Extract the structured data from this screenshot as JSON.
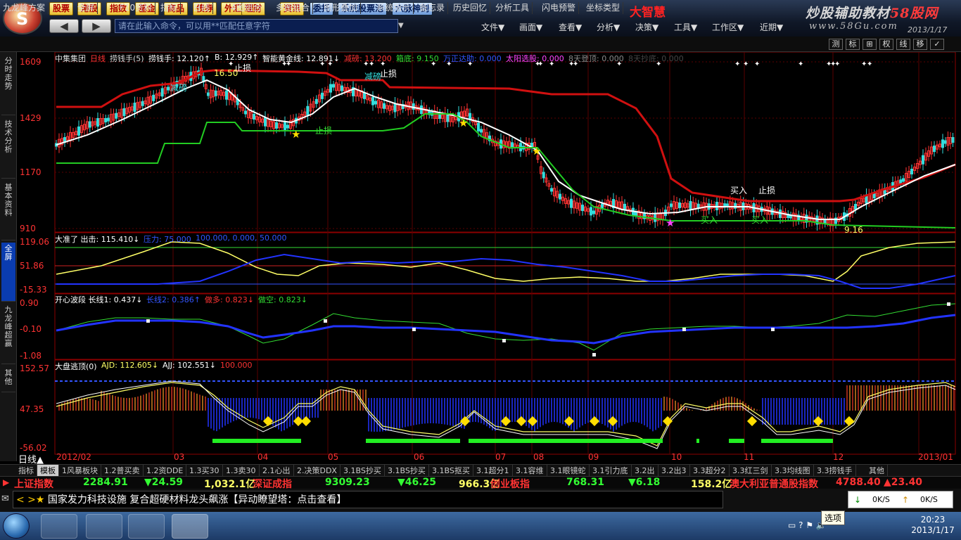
{
  "top_menu": [
    "股票",
    "港股",
    "指数",
    "基金",
    "商品",
    "债券",
    "外汇",
    "理财",
    "资讯",
    "委托",
    "系统股票池",
    "六脉神剑"
  ],
  "brand": "大智慧",
  "watermark": {
    "line1a": "炒股辅助教材",
    "line1b": "58股网",
    "line2": "www.58Gu.com",
    "date": "2013/1/17"
  },
  "command": {
    "placeholder": "请在此输入命令，可以用**匹配任意字符"
  },
  "main_menu": [
    "文件▼",
    "画面▼",
    "查看▼",
    "分析▼",
    "决策▼",
    "工具▼",
    "工作区▼",
    "近期▼"
  ],
  "toolbar2": [
    "九龙峰方案",
    "全屏",
    "F10资料",
    "指标",
    "日线",
    "4图组合",
    "多图组合",
    "图形叠加",
    "系统指示",
    "备忘录",
    "历史回忆",
    "分析工具",
    "闪电预警",
    "坐标类型"
  ],
  "right_btns": [
    "测",
    "标",
    "⊞",
    "权",
    "线",
    "移",
    "✓"
  ],
  "left_tabs": [
    "分时走势",
    "技术分析",
    "基本资料",
    "全屏",
    "九龙峰超赢",
    "其他"
  ],
  "main_panel": {
    "header": [
      {
        "t": "中集集团",
        "c": "#ddd"
      },
      {
        "t": "日线",
        "c": "#ff3333"
      },
      {
        "t": "捞钱手(5)",
        "c": "#ddd"
      },
      {
        "t": "捞钱手: 12.120↑",
        "c": "#fff"
      },
      {
        "t": "B: 12.929↑",
        "c": "#fff"
      },
      {
        "t": "智能黄金线: 12.891↓",
        "c": "#fff"
      },
      {
        "t": "减磅: 13.200",
        "c": "#ff3333"
      },
      {
        "t": "箱底: 9.150",
        "c": "#33dd33"
      },
      {
        "t": "万正达助: 0.000",
        "c": "#3355ff"
      },
      {
        "t": "太阳选股: 0.000",
        "c": "#ff44ff"
      },
      {
        "t": "8天登顶: 0.000",
        "c": "#888"
      },
      {
        "t": "8天抄底: 0.000",
        "c": "#444"
      }
    ],
    "y_labels": [
      "1609",
      "1429",
      "1170",
      "910"
    ],
    "annotations": [
      "减磅",
      "止损",
      "16.50",
      "减磅",
      "止损",
      "买入",
      "止损",
      "止损",
      "买入",
      "买入",
      "9.16"
    ]
  },
  "panel2": {
    "header": [
      {
        "t": "大准了 出击: 115.410↓",
        "c": "#fff"
      },
      {
        "t": "压力: 75.000",
        "c": "#3355ff"
      },
      {
        "t": "100.000, 0.000, 50.000",
        "c": "#3355ff"
      }
    ],
    "y_labels": [
      "119.06",
      "51.86",
      "-15.33"
    ]
  },
  "panel3": {
    "header": [
      {
        "t": "开心波段 长线1: 0.437↓",
        "c": "#fff"
      },
      {
        "t": "长线2: 0.386↑",
        "c": "#3355ff"
      },
      {
        "t": "做多: 0.823↓",
        "c": "#ff3333"
      },
      {
        "t": "做空: 0.823↓",
        "c": "#33dd33"
      }
    ],
    "y_labels": [
      "0.90",
      "-0.10",
      "-1.08"
    ]
  },
  "panel4": {
    "header": [
      {
        "t": "大盘逃顶(0)",
        "c": "#fff"
      },
      {
        "t": "AJD: 112.605↓",
        "c": "#ffff66"
      },
      {
        "t": "AJJ: 102.551↓",
        "c": "#fff"
      },
      {
        "t": "100.000",
        "c": "#ff3333"
      }
    ],
    "y_labels": [
      "152.57",
      "47.35",
      "-56.02"
    ]
  },
  "x_labels": [
    "2012/02",
    "03",
    "04",
    "05",
    "06",
    "07",
    "08",
    "09",
    "10",
    "11",
    "12",
    "2013/01"
  ],
  "period": "日线▲",
  "formula_tabs": [
    "指标",
    "模板",
    "1风暴板块",
    "1.2普买卖",
    "1.2资DDE",
    "1.3买30",
    "1.3卖30",
    "2.1心出",
    "2.决策DDX",
    "3.1BS抄买",
    "3.1BS抄买",
    "3.1BS抠买",
    "3.1超分1",
    "3.1容维",
    "3.1眼镜蛇",
    "3.1引力底",
    "3.2出",
    "3.2出3",
    "3.3超分2",
    "3.3红三剑",
    "3.3均线图",
    "3.3捞钱手",
    "其他"
  ],
  "ticker": [
    {
      "t": "上证指数",
      "c": "#ff3333"
    },
    {
      "t": "2284.91",
      "c": "#33ff33"
    },
    {
      "t": "▼24.59",
      "c": "#33ff33"
    },
    {
      "t": "1,032.1亿",
      "c": "#ffff66"
    },
    {
      "t": "深证成指",
      "c": "#ff3333"
    },
    {
      "t": "9309.23",
      "c": "#33ff33"
    },
    {
      "t": "▼46.25",
      "c": "#33ff33"
    },
    {
      "t": "966.3亿",
      "c": "#ffff66"
    },
    {
      "t": "创业板指",
      "c": "#ff3333"
    },
    {
      "t": "768.31",
      "c": "#33ff33"
    },
    {
      "t": "▼6.18",
      "c": "#33ff33"
    },
    {
      "t": "158.2亿",
      "c": "#ffff66"
    },
    {
      "t": "澳大利亚普通股指数",
      "c": "#ff3333"
    },
    {
      "t": "4788.40",
      "c": "#ff3333"
    },
    {
      "t": "▲23.40",
      "c": "#ff3333"
    }
  ],
  "news": "国家发力科技设施 复合超硬材料龙头飙涨【异动瞭望塔：点击查看】",
  "net": {
    "down": "0K/S",
    "up": "0K/S"
  },
  "tooltip": "选项",
  "clock": {
    "time": "20:23",
    "date": "2013/1/17"
  }
}
